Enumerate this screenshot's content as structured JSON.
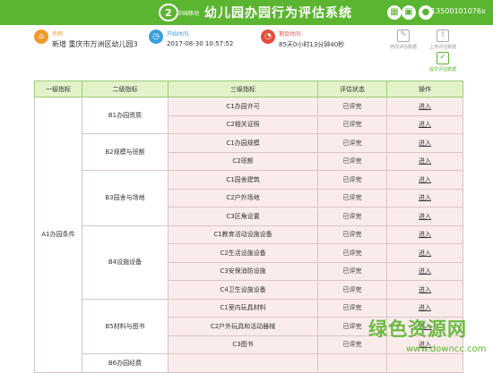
{
  "header": {
    "logo_text": "中国移动",
    "title": "幼儿园办园行为评估系统",
    "user_id": "13500101076x",
    "accent": "#5cb531"
  },
  "info": {
    "school": {
      "label": "名称:",
      "value": "新增 重庆市万洲区幼儿园3"
    },
    "start": {
      "label": "开始时间:",
      "value": "2017-08-30 10:57:52"
    },
    "remaining": {
      "label": "剩余时间:",
      "value": "85天0小时13分钟40秒"
    }
  },
  "actions": [
    {
      "label": "修改评估数据"
    },
    {
      "label": "上传评估数据"
    },
    {
      "label": "提交评估数据"
    }
  ],
  "table": {
    "headers": [
      "一级指标",
      "二级指标",
      "三级指标",
      "评估状态",
      "操作"
    ],
    "level1": "A1办园条件",
    "groups": [
      {
        "level2": "B1办园资质",
        "rows": [
          {
            "level3": "C1办园许可",
            "status": "已评完",
            "action": "进入"
          },
          {
            "level3": "C2相关证照",
            "status": "已评完",
            "action": "进入"
          }
        ]
      },
      {
        "level2": "B2规模与班额",
        "rows": [
          {
            "level3": "C1办园规模",
            "status": "已评完",
            "action": "进入"
          },
          {
            "level3": "C2班额",
            "status": "已评完",
            "action": "进入"
          }
        ]
      },
      {
        "level2": "B3园舍与场地",
        "rows": [
          {
            "level3": "C1园舍建筑",
            "status": "已评完",
            "action": "进入"
          },
          {
            "level3": "C2户外场地",
            "status": "已评完",
            "action": "进入"
          },
          {
            "level3": "C3区角设置",
            "status": "已评完",
            "action": "进入"
          }
        ]
      },
      {
        "level2": "B4设施设备",
        "rows": [
          {
            "level3": "C1教育活动设施设备",
            "status": "已评完",
            "action": "进入"
          },
          {
            "level3": "C2生活设施设备",
            "status": "已评完",
            "action": "进入"
          },
          {
            "level3": "C3安保消防设施",
            "status": "已评完",
            "action": "进入"
          },
          {
            "level3": "C4卫生设施设备",
            "status": "已评完",
            "action": "进入"
          }
        ]
      },
      {
        "level2": "B5材料与图书",
        "rows": [
          {
            "level3": "C1室内玩具材料",
            "status": "已评完",
            "action": "进入"
          },
          {
            "level3": "C2户外玩具和活动器械",
            "status": "已评完",
            "action": "进入"
          },
          {
            "level3": "C3图书",
            "status": "已评完",
            "action": "进入"
          }
        ]
      },
      {
        "level2": "B6办园经费",
        "rows": [
          {
            "level3": "",
            "status": "",
            "action": ""
          }
        ]
      }
    ]
  },
  "watermark": {
    "text": "绿色资源网",
    "url": "www.downcc.com"
  }
}
